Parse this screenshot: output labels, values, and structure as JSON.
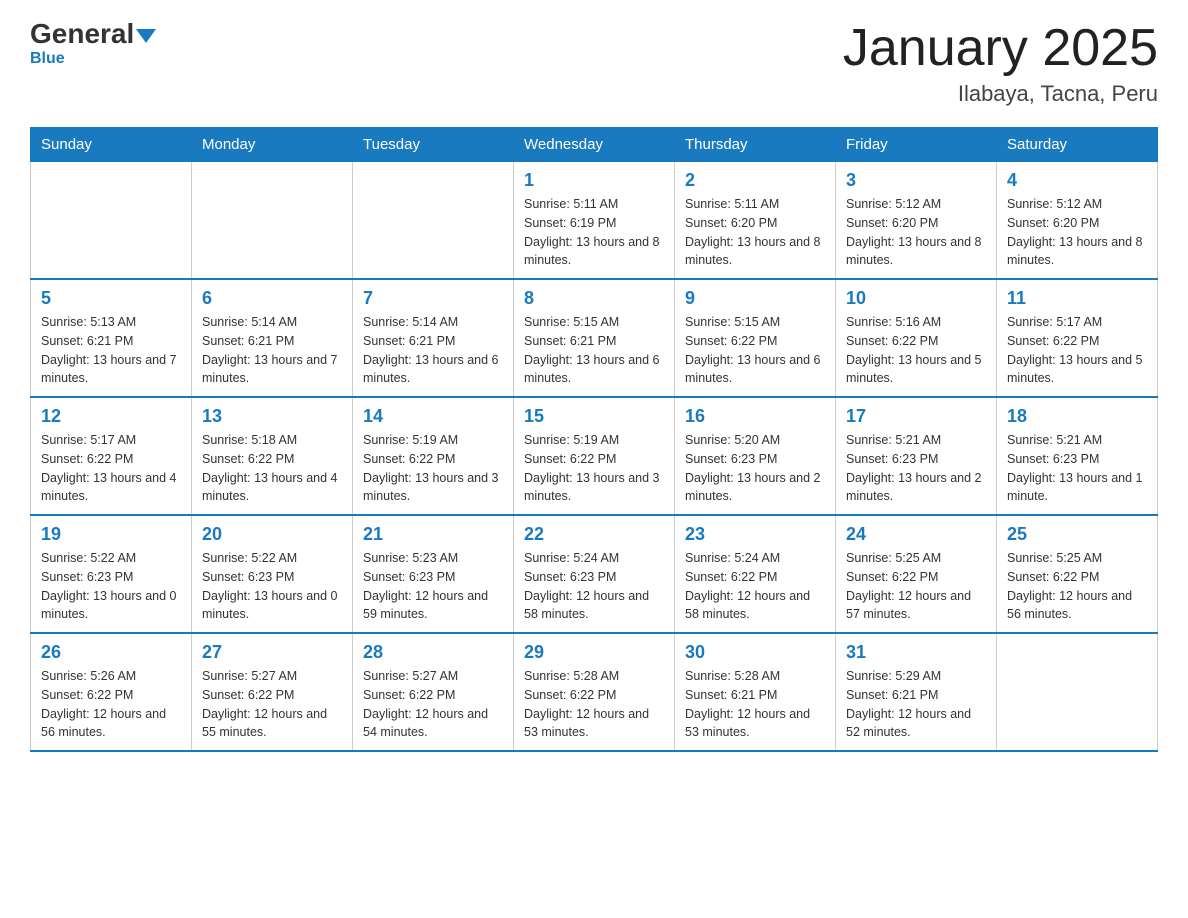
{
  "header": {
    "logo_general": "General",
    "logo_blue": "Blue",
    "title": "January 2025",
    "subtitle": "Ilabaya, Tacna, Peru"
  },
  "days_of_week": [
    "Sunday",
    "Monday",
    "Tuesday",
    "Wednesday",
    "Thursday",
    "Friday",
    "Saturday"
  ],
  "weeks": [
    [
      {
        "day": "",
        "info": ""
      },
      {
        "day": "",
        "info": ""
      },
      {
        "day": "",
        "info": ""
      },
      {
        "day": "1",
        "info": "Sunrise: 5:11 AM\nSunset: 6:19 PM\nDaylight: 13 hours and 8 minutes."
      },
      {
        "day": "2",
        "info": "Sunrise: 5:11 AM\nSunset: 6:20 PM\nDaylight: 13 hours and 8 minutes."
      },
      {
        "day": "3",
        "info": "Sunrise: 5:12 AM\nSunset: 6:20 PM\nDaylight: 13 hours and 8 minutes."
      },
      {
        "day": "4",
        "info": "Sunrise: 5:12 AM\nSunset: 6:20 PM\nDaylight: 13 hours and 8 minutes."
      }
    ],
    [
      {
        "day": "5",
        "info": "Sunrise: 5:13 AM\nSunset: 6:21 PM\nDaylight: 13 hours and 7 minutes."
      },
      {
        "day": "6",
        "info": "Sunrise: 5:14 AM\nSunset: 6:21 PM\nDaylight: 13 hours and 7 minutes."
      },
      {
        "day": "7",
        "info": "Sunrise: 5:14 AM\nSunset: 6:21 PM\nDaylight: 13 hours and 6 minutes."
      },
      {
        "day": "8",
        "info": "Sunrise: 5:15 AM\nSunset: 6:21 PM\nDaylight: 13 hours and 6 minutes."
      },
      {
        "day": "9",
        "info": "Sunrise: 5:15 AM\nSunset: 6:22 PM\nDaylight: 13 hours and 6 minutes."
      },
      {
        "day": "10",
        "info": "Sunrise: 5:16 AM\nSunset: 6:22 PM\nDaylight: 13 hours and 5 minutes."
      },
      {
        "day": "11",
        "info": "Sunrise: 5:17 AM\nSunset: 6:22 PM\nDaylight: 13 hours and 5 minutes."
      }
    ],
    [
      {
        "day": "12",
        "info": "Sunrise: 5:17 AM\nSunset: 6:22 PM\nDaylight: 13 hours and 4 minutes."
      },
      {
        "day": "13",
        "info": "Sunrise: 5:18 AM\nSunset: 6:22 PM\nDaylight: 13 hours and 4 minutes."
      },
      {
        "day": "14",
        "info": "Sunrise: 5:19 AM\nSunset: 6:22 PM\nDaylight: 13 hours and 3 minutes."
      },
      {
        "day": "15",
        "info": "Sunrise: 5:19 AM\nSunset: 6:22 PM\nDaylight: 13 hours and 3 minutes."
      },
      {
        "day": "16",
        "info": "Sunrise: 5:20 AM\nSunset: 6:23 PM\nDaylight: 13 hours and 2 minutes."
      },
      {
        "day": "17",
        "info": "Sunrise: 5:21 AM\nSunset: 6:23 PM\nDaylight: 13 hours and 2 minutes."
      },
      {
        "day": "18",
        "info": "Sunrise: 5:21 AM\nSunset: 6:23 PM\nDaylight: 13 hours and 1 minute."
      }
    ],
    [
      {
        "day": "19",
        "info": "Sunrise: 5:22 AM\nSunset: 6:23 PM\nDaylight: 13 hours and 0 minutes."
      },
      {
        "day": "20",
        "info": "Sunrise: 5:22 AM\nSunset: 6:23 PM\nDaylight: 13 hours and 0 minutes."
      },
      {
        "day": "21",
        "info": "Sunrise: 5:23 AM\nSunset: 6:23 PM\nDaylight: 12 hours and 59 minutes."
      },
      {
        "day": "22",
        "info": "Sunrise: 5:24 AM\nSunset: 6:23 PM\nDaylight: 12 hours and 58 minutes."
      },
      {
        "day": "23",
        "info": "Sunrise: 5:24 AM\nSunset: 6:22 PM\nDaylight: 12 hours and 58 minutes."
      },
      {
        "day": "24",
        "info": "Sunrise: 5:25 AM\nSunset: 6:22 PM\nDaylight: 12 hours and 57 minutes."
      },
      {
        "day": "25",
        "info": "Sunrise: 5:25 AM\nSunset: 6:22 PM\nDaylight: 12 hours and 56 minutes."
      }
    ],
    [
      {
        "day": "26",
        "info": "Sunrise: 5:26 AM\nSunset: 6:22 PM\nDaylight: 12 hours and 56 minutes."
      },
      {
        "day": "27",
        "info": "Sunrise: 5:27 AM\nSunset: 6:22 PM\nDaylight: 12 hours and 55 minutes."
      },
      {
        "day": "28",
        "info": "Sunrise: 5:27 AM\nSunset: 6:22 PM\nDaylight: 12 hours and 54 minutes."
      },
      {
        "day": "29",
        "info": "Sunrise: 5:28 AM\nSunset: 6:22 PM\nDaylight: 12 hours and 53 minutes."
      },
      {
        "day": "30",
        "info": "Sunrise: 5:28 AM\nSunset: 6:21 PM\nDaylight: 12 hours and 53 minutes."
      },
      {
        "day": "31",
        "info": "Sunrise: 5:29 AM\nSunset: 6:21 PM\nDaylight: 12 hours and 52 minutes."
      },
      {
        "day": "",
        "info": ""
      }
    ]
  ]
}
